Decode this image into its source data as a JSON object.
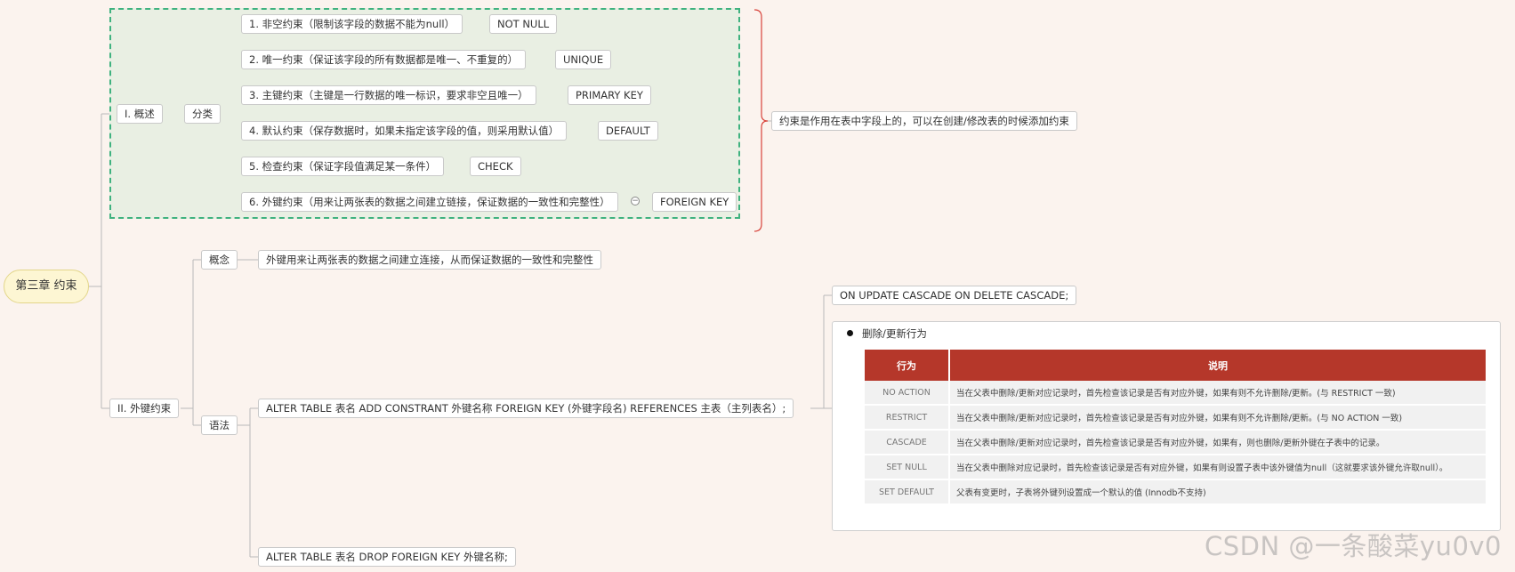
{
  "root": "第三章 约束",
  "overview": {
    "label": "I. 概述",
    "category": "分类",
    "note": "约束是作用在表中字段上的，可以在创建/修改表的时候添加约束",
    "constraints": [
      {
        "desc": "1. 非空约束（限制该字段的数据不能为null）",
        "keyword": "NOT NULL"
      },
      {
        "desc": "2. 唯一约束（保证该字段的所有数据都是唯一、不重复的）",
        "keyword": "UNIQUE"
      },
      {
        "desc": "3. 主键约束（主键是一行数据的唯一标识，要求非空且唯一）",
        "keyword": "PRIMARY KEY"
      },
      {
        "desc": "4. 默认约束（保存数据时，如果未指定该字段的值，则采用默认值）",
        "keyword": "DEFAULT"
      },
      {
        "desc": "5. 检查约束（保证字段值满足某一条件）",
        "keyword": "CHECK"
      },
      {
        "desc": "6. 外键约束（用来让两张表的数据之间建立链接，保证数据的一致性和完整性）",
        "keyword": "FOREIGN KEY"
      }
    ],
    "collapse_symbol": "−"
  },
  "foreign_key": {
    "label": "II. 外键约束",
    "concept_label": "概念",
    "concept_text": "外键用来让两张表的数据之间建立连接，从而保证数据的一致性和完整性",
    "syntax_label": "语法",
    "add_syntax": "ALTER TABLE 表名 ADD CONSTRANT 外键名称 FOREIGN KEY (外键字段名)   REFERENCES 主表（主列表名）;",
    "cascade_syntax": "ON UPDATE CASCADE ON DELETE CASCADE;",
    "drop_syntax": "ALTER TABLE 表名 DROP FOREIGN KEY 外键名称;",
    "panel": {
      "title": "删除/更新行为",
      "headers": [
        "行为",
        "说明"
      ],
      "rows": [
        {
          "action": "NO  ACTION",
          "desc": "当在父表中删除/更新对应记录时，首先检查该记录是否有对应外键，如果有则不允许删除/更新。(与 RESTRICT 一致)"
        },
        {
          "action": "RESTRICT",
          "desc": "当在父表中删除/更新对应记录时，首先检查该记录是否有对应外键，如果有则不允许删除/更新。(与 NO ACTION 一致)"
        },
        {
          "action": "CASCADE",
          "desc": "当在父表中删除/更新对应记录时，首先检查该记录是否有对应外键，如果有，则也删除/更新外键在子表中的记录。"
        },
        {
          "action": "SET  NULL",
          "desc": "当在父表中删除对应记录时，首先检查该记录是否有对应外键，如果有则设置子表中该外键值为null（这就要求该外键允许取null）。"
        },
        {
          "action": "SET  DEFAULT",
          "desc": "父表有变更时，子表将外键列设置成一个默认的值 (Innodb不支持)"
        }
      ]
    }
  },
  "watermark": "CSDN @一条酸菜yu0v0",
  "colors": {
    "background": "#fbf3ee",
    "group_border": "#3fb27f",
    "brace": "#d8433b",
    "table_header": "#b5372a"
  }
}
